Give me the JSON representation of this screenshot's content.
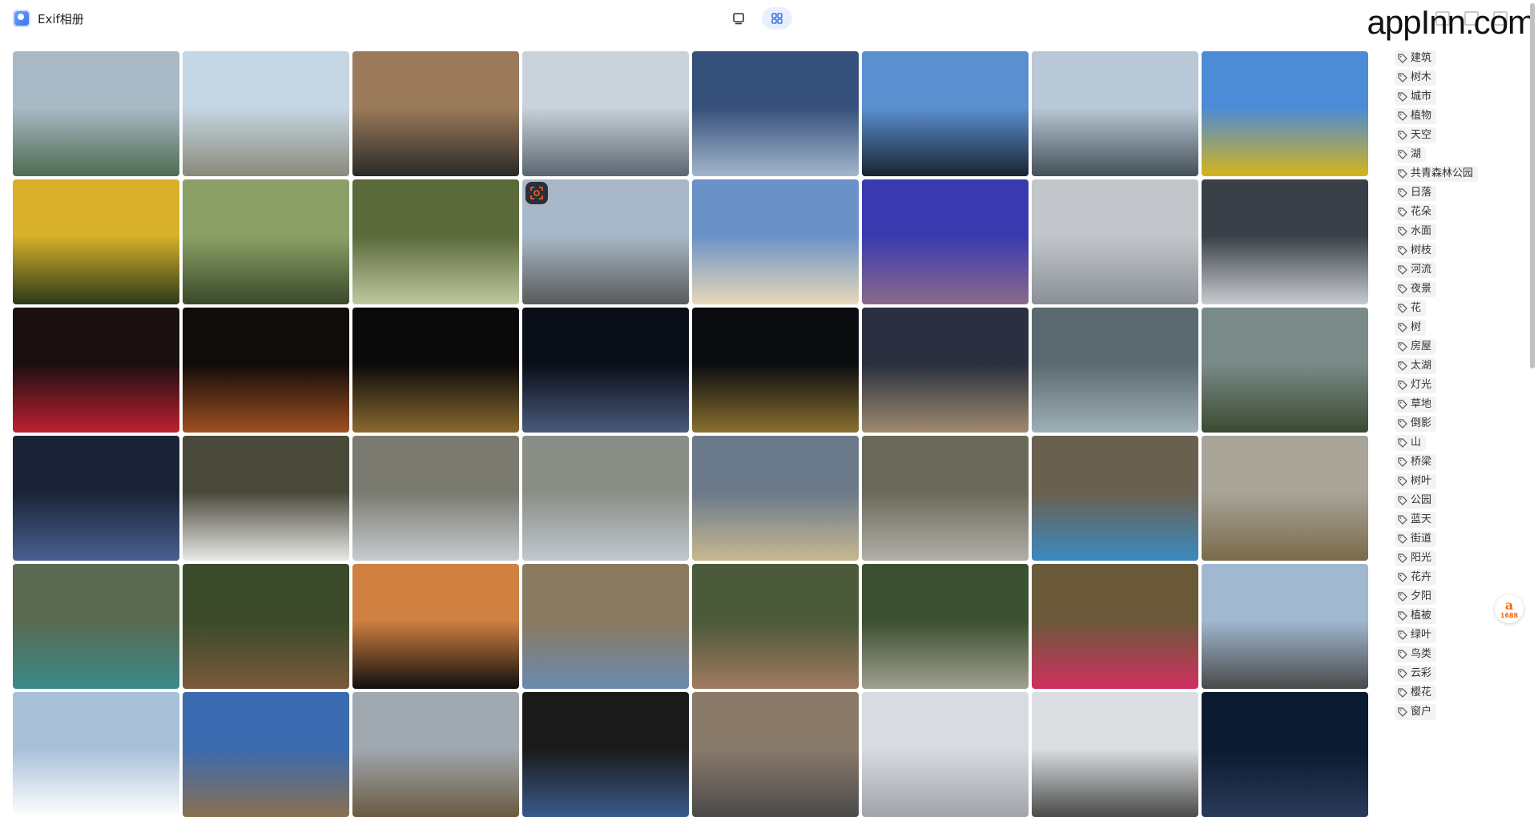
{
  "app": {
    "title": "Exif相册",
    "watermark": "appInn.com"
  },
  "view_toggle": [
    {
      "name": "single-view",
      "active": false
    },
    {
      "name": "grid-view",
      "active": true
    }
  ],
  "photos": [
    [
      "#a9b9c6",
      "#4f6b52"
    ],
    [
      "#c5d6e4",
      "#8a8a7a"
    ],
    [
      "#9a7a5a",
      "#2a2a28"
    ],
    [
      "#c9d2da",
      "#5a6670"
    ],
    [
      "#36507c",
      "#a3b6cc"
    ],
    [
      "#5a8fd0",
      "#1a2432"
    ],
    [
      "#b9c8d6",
      "#445058"
    ],
    [
      "#4c8bd6",
      "#d4b41c"
    ],
    [
      "#d8b02a",
      "#2a3a1a"
    ],
    [
      "#8aa066",
      "#3a4a2a"
    ],
    [
      "#5a6a3a",
      "#c0c8a0"
    ],
    [
      "#a8b8c8",
      "#5a5a5a"
    ],
    [
      "#6a92c8",
      "#e8d8b8"
    ],
    [
      "#3a3ab0",
      "#8a6a8a"
    ],
    [
      "#c2c6ca",
      "#8a9096"
    ],
    [
      "#3a4048",
      "#c8ccd0"
    ],
    [
      "#1a1010",
      "#c02030"
    ],
    [
      "#100c0a",
      "#a05020"
    ],
    [
      "#0a0a0a",
      "#8a6a30"
    ],
    [
      "#0a0e18",
      "#4a5a7a"
    ],
    [
      "#0a0c10",
      "#8a7030"
    ],
    [
      "#2a3040",
      "#a08a70"
    ],
    [
      "#5a6a70",
      "#a0b0b8"
    ],
    [
      "#7a8a88",
      "#3a4a30"
    ],
    [
      "#1a2436",
      "#4a6090"
    ],
    [
      "#4a4a3a",
      "#e8e8e8"
    ],
    [
      "#7a7a70",
      "#c8ccd0"
    ],
    [
      "#8a8e86",
      "#c0c8d0"
    ],
    [
      "#6a7a8a",
      "#c8b890"
    ],
    [
      "#6a6a5a",
      "#b0b0a8"
    ],
    [
      "#6a6050",
      "#3a8ac0"
    ],
    [
      "#a8a498",
      "#7a6a4a"
    ],
    [
      "#5a6a50",
      "#3a8a8a"
    ],
    [
      "#3a4a2a",
      "#7a5a3a"
    ],
    [
      "#d08040",
      "#101010"
    ],
    [
      "#8a7a60",
      "#6a8ab0"
    ],
    [
      "#4a5a3a",
      "#a07a60"
    ],
    [
      "#3a5030",
      "#a0a090"
    ],
    [
      "#6a5a3a",
      "#d03060"
    ],
    [
      "#a0b8d0",
      "#4a4a4a"
    ],
    [
      "#a8c0d8",
      "#ffffff"
    ],
    [
      "#3a6ab0",
      "#8a7050"
    ],
    [
      "#a0a8b0",
      "#6a5a40"
    ],
    [
      "#1a1a1a",
      "#3a5a8a"
    ],
    [
      "#8a7a6a",
      "#4a4a4a"
    ],
    [
      "#d8dce0",
      "#a0a4a8"
    ],
    [
      "#dcdfe2",
      "#4a4a4a"
    ],
    [
      "#0a1a30",
      "#2a3a5a"
    ]
  ],
  "tags": [
    "建筑",
    "树木",
    "城市",
    "植物",
    "天空",
    "湖",
    "共青森林公园",
    "日落",
    "花朵",
    "水面",
    "树枝",
    "河流",
    "夜景",
    "花",
    "树",
    "房屋",
    "太湖",
    "灯光",
    "草地",
    "倒影",
    "山",
    "桥梁",
    "树叶",
    "公园",
    "蓝天",
    "街道",
    "阳光",
    "花卉",
    "夕阳",
    "植被",
    "绿叶",
    "鸟类",
    "云彩",
    "樱花",
    "窗户"
  ],
  "float_logo": {
    "label": "1688"
  }
}
